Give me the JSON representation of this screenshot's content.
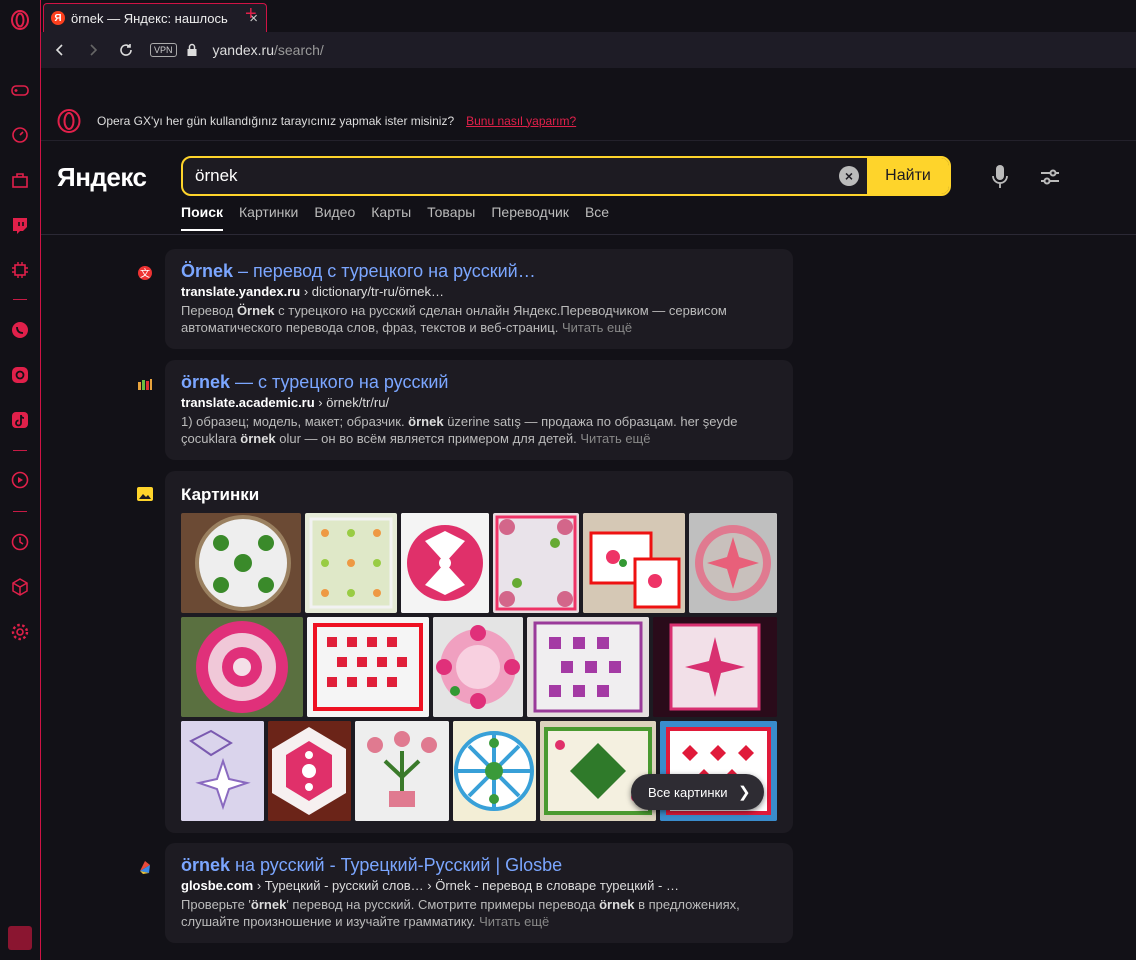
{
  "browser": {
    "tab_title": "örnek — Яндекс: нашлось",
    "tab_favicon": "Я",
    "url_host": "yandex.ru",
    "url_path": "/search/",
    "vpn_label": "VPN",
    "accent": "#cf1345"
  },
  "banner": {
    "text": "Opera GX'yı her gün kullandığınız tarayıcınız yapmak ister misiniz?",
    "link": "Bunu nasıl yaparım?"
  },
  "header": {
    "logo": "Яндекс",
    "query": "örnek",
    "find_label": "Найти",
    "tabs": [
      "Поиск",
      "Картинки",
      "Видео",
      "Карты",
      "Товары",
      "Переводчик",
      "Все"
    ]
  },
  "results": [
    {
      "title_bold": "Örnek",
      "title_rest": " – перевод с турецкого на русский…",
      "url_host": "translate.yandex.ru",
      "url_path": " › dictionary/tr-ru/örnek…",
      "snippet_1": "Перевод ",
      "snippet_b1": "Örnek",
      "snippet_2": " с турецкого на русский сделан онлайн Яндекс.Переводчиком — сервисом автоматического перевода слов, фраз, текстов и веб-страниц.",
      "more": "Читать ещё"
    },
    {
      "title_bold": "örnek",
      "title_rest": " — с турецкого на русский",
      "url_host": "translate.academic.ru",
      "url_path": " › örnek/tr/ru/",
      "snippet_1": "1) образец; модель, макет; образчик. ",
      "snippet_b1": "örnek",
      "snippet_2": " üzerine satış — продажа по образцам. her şeyde çocuklara ",
      "snippet_b2": "örnek",
      "snippet_3": " olur — он во всём является примером для детей.",
      "more": "Читать ещё"
    },
    {
      "title_bold": "örnek",
      "title_rest": " на русский - Турецкий-Русский | Glosbe",
      "url_host": "glosbe.com",
      "url_path": " › Турецкий - русский слов… › Örnek - перевод в словаре турецкий - …",
      "snippet_1": "Проверьте '",
      "snippet_b1": "örnek",
      "snippet_2": "' перевод на русский. Смотрите примеры перевода ",
      "snippet_b2": "örnek",
      "snippet_3": " в предложениях, слушайте произношение и изучайте грамматику.",
      "more": "Читать ещё"
    }
  ],
  "images": {
    "title": "Картинки",
    "all_label": "Все картинки"
  }
}
